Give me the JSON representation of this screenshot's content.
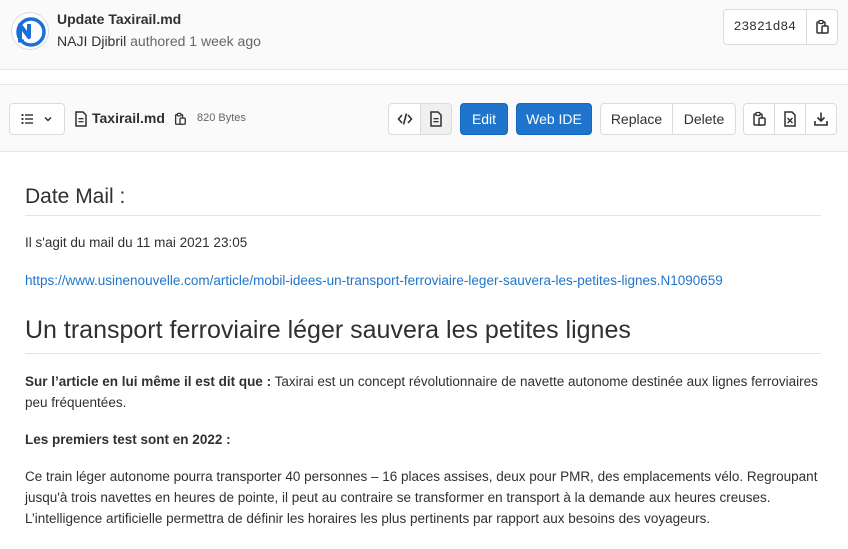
{
  "commit": {
    "title": "Update Taxirail.md",
    "author": "NAJI Djibril",
    "meta_suffix": "authored 1 week ago",
    "sha": "23821d84"
  },
  "file": {
    "name": "Taxirail.md",
    "size": "820 Bytes"
  },
  "toolbar": {
    "edit_label": "Edit",
    "web_ide_label": "Web IDE",
    "replace_label": "Replace",
    "delete_label": "Delete"
  },
  "doc": {
    "heading_date": "Date Mail :",
    "mail_sentence": "Il s'agit du mail du 11 mai 2021 23:05",
    "link_text": "https://www.usinenouvelle.com/article/mobil-idees-un-transport-ferroviaire-leger-sauvera-les-petites-lignes.N1090659",
    "heading_main": "Un transport ferroviaire léger sauvera les petites lignes",
    "p2_bold": "Sur l’article en lui même il est dit que :",
    "p2_text": " Taxirai est un concept révolutionnaire de navette autonome destinée aux lignes ferroviaires peu fréquentées.",
    "p3_bold": "Les premiers test sont en 2022 :",
    "p4_text": "Ce train léger autonome pourra transporter 40 personnes – 16 places assises, deux pour PMR, des emplacements vélo. Regroupant jusqu'à trois navettes en heures de pointe, il peut au contraire se transformer en transport à la demande aux heures creuses. L’intelligence artificielle permettra de définir les horaires les plus pertinents par rapport aux besoins des voyageurs."
  },
  "colors": {
    "primary_blue": "#1f75cb",
    "avatar_blue": "#1a6fd8"
  }
}
